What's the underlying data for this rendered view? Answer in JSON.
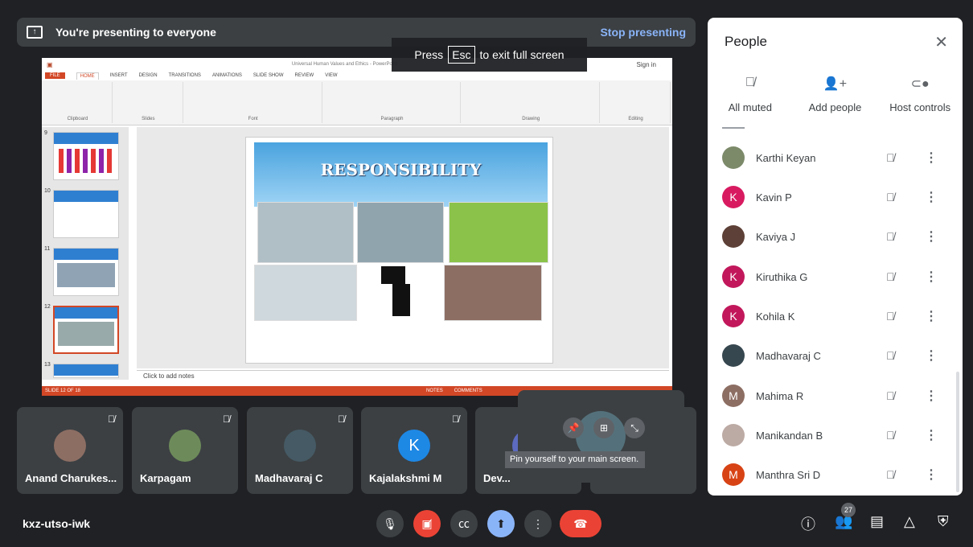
{
  "banner": {
    "text": "You're presenting to everyone",
    "stop": "Stop presenting"
  },
  "esc": {
    "press": "Press",
    "key": "Esc",
    "rest": "to exit full screen"
  },
  "ppt": {
    "title": "Universal Human Values and Ethics - PowerPoint",
    "tabs": [
      "FILE",
      "HOME",
      "INSERT",
      "DESIGN",
      "TRANSITIONS",
      "ANIMATIONS",
      "SLIDE SHOW",
      "REVIEW",
      "VIEW"
    ],
    "signin": "Sign in",
    "groups": [
      "Clipboard",
      "Slides",
      "Font",
      "Paragraph",
      "Drawing",
      "Editing"
    ],
    "thumb_numbers": [
      "9",
      "10",
      "11",
      "12",
      "13"
    ],
    "slide_title": "RESPONSIBILITY",
    "notes": "Click to add notes",
    "status": "SLIDE 12 OF 18",
    "status_notes": "NOTES",
    "status_comments": "COMMENTS"
  },
  "tiles": [
    {
      "name": "Anand Charukes...",
      "initial": "",
      "color": "#8d6e63"
    },
    {
      "name": "Karpagam",
      "initial": "",
      "color": "#6d8b5a"
    },
    {
      "name": "Madhavaraj C",
      "initial": "",
      "color": "#455a64"
    },
    {
      "name": "Kajalakshmi M",
      "initial": "K",
      "color": "#1e88e5"
    },
    {
      "name": "Dev...",
      "initial": "",
      "color": "#5c6bc0"
    }
  ],
  "pin": {
    "tip": "Pin yourself to your main screen."
  },
  "panel": {
    "title": "People",
    "actions": [
      {
        "label": "All muted",
        "icon": "mic-off-icon"
      },
      {
        "label": "Add people",
        "icon": "add-person-icon"
      },
      {
        "label": "Host controls",
        "icon": "toggle-icon"
      }
    ],
    "people": [
      {
        "name": "Karthi Keyan",
        "initial": "",
        "color": "#7c8a6a"
      },
      {
        "name": "Kavin P",
        "initial": "K",
        "color": "#d81b60"
      },
      {
        "name": "Kaviya J",
        "initial": "",
        "color": "#5d4037"
      },
      {
        "name": "Kiruthika G",
        "initial": "K",
        "color": "#c2185b"
      },
      {
        "name": "Kohila K",
        "initial": "K",
        "color": "#c2185b"
      },
      {
        "name": "Madhavaraj C",
        "initial": "",
        "color": "#37474f"
      },
      {
        "name": "Mahima R",
        "initial": "M",
        "color": "#8d6e63"
      },
      {
        "name": "Manikandan B",
        "initial": "",
        "color": "#bcaaa4"
      },
      {
        "name": "Manthra Sri D",
        "initial": "M",
        "color": "#d84315"
      }
    ]
  },
  "bottom": {
    "code": "kxz-utso-iwk",
    "people_count": "27"
  }
}
